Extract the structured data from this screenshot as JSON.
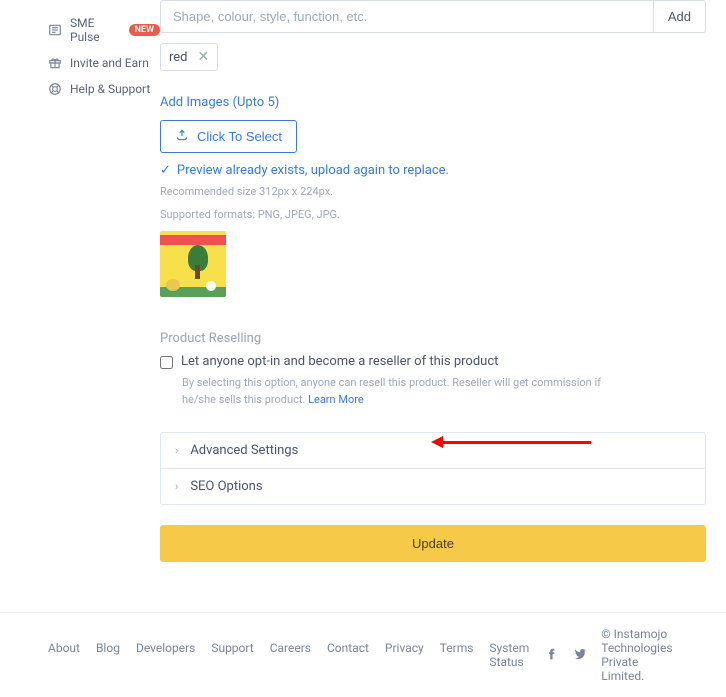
{
  "sidebar": {
    "items": [
      {
        "label": "SME Pulse",
        "badge": "NEW"
      },
      {
        "label": "Invite and Earn"
      },
      {
        "label": "Help & Support"
      }
    ]
  },
  "tags": {
    "placeholder": "Shape, colour, style, function, etc.",
    "add_label": "Add",
    "chips": [
      "red"
    ]
  },
  "images": {
    "heading": "Add Images (Upto 5)",
    "select_label": "Click To Select",
    "preview_note": "Preview already exists, upload again to replace.",
    "hint_size": "Recommended size 312px x 224px.",
    "hint_formats": "Supported formats: PNG, JPEG, JPG."
  },
  "resell": {
    "heading": "Product Reselling",
    "checkbox_label": "Let anyone opt-in and become a reseller of this product",
    "hint": "By selecting this option, anyone can resell this product. Reseller will get commission if he/she sells this product. ",
    "learn_more": "Learn More"
  },
  "accordion": {
    "advanced": "Advanced Settings",
    "seo": "SEO Options"
  },
  "actions": {
    "update": "Update"
  },
  "footer": {
    "links": [
      "About",
      "Blog",
      "Developers",
      "Support",
      "Careers",
      "Contact",
      "Privacy",
      "Terms",
      "System Status"
    ],
    "copyright": "© Instamojo Technologies Private Limited."
  }
}
